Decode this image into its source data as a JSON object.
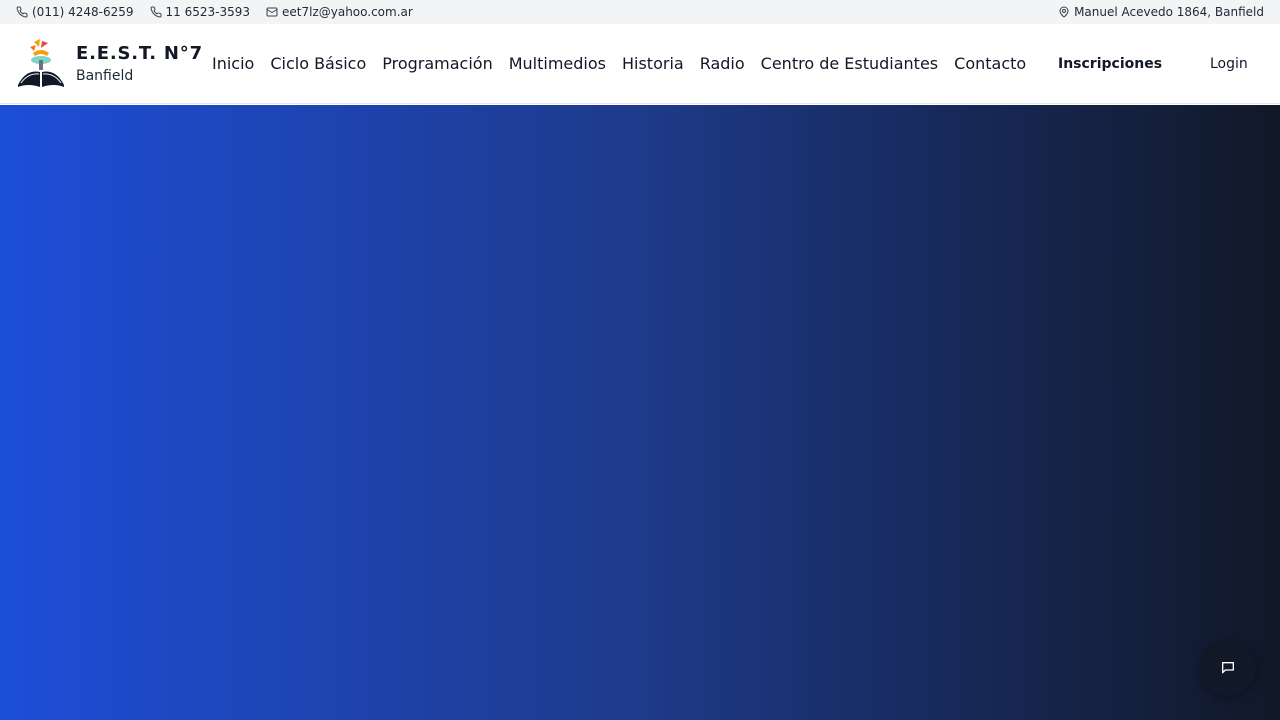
{
  "topbar": {
    "phone1": "(011) 4248-6259",
    "phone2": "11 6523-3593",
    "email": "eet7lz@yahoo.com.ar",
    "address": "Manuel Acevedo 1864, Banfield"
  },
  "brand": {
    "title": "E.E.S.T. N°7",
    "subtitle": "Banfield"
  },
  "nav": {
    "items": [
      "Inicio",
      "Ciclo Básico",
      "Programación",
      "Multimedios",
      "Historia",
      "Radio",
      "Centro de Estudiantes",
      "Contacto"
    ]
  },
  "actions": {
    "cta_label": "Inscripciones",
    "login_label": "Login"
  },
  "hero": {
    "heading": "",
    "gradient_colors": [
      "#1d4ed8",
      "#1e3a8a",
      "#111827"
    ]
  },
  "icons": {
    "phone": "phone-icon",
    "mail": "mail-icon",
    "location": "map-pin-icon",
    "chat": "chat-icon"
  }
}
